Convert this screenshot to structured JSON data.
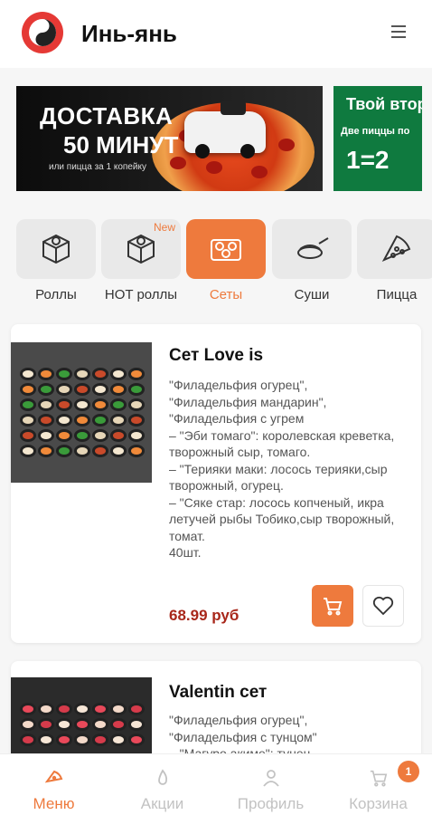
{
  "header": {
    "title": "Инь-янь"
  },
  "banners": [
    {
      "line1": "ДОСТАВКА",
      "line2": "50 МИНУТ",
      "line3": "или пицца за 1 копейку"
    },
    {
      "line1": "Твой втор",
      "line2": "Две пиццы по",
      "line3": "1=2"
    }
  ],
  "categories": [
    {
      "label": "Роллы",
      "icon": "roll-icon",
      "badge": ""
    },
    {
      "label": "HOT роллы",
      "icon": "hot-roll-icon",
      "badge": "New"
    },
    {
      "label": "Сеты",
      "icon": "set-icon",
      "badge": ""
    },
    {
      "label": "Суши",
      "icon": "sushi-icon",
      "badge": ""
    },
    {
      "label": "Пицца",
      "icon": "pizza-icon",
      "badge": ""
    }
  ],
  "products": [
    {
      "title": "Сет Love is",
      "description": "\"Филадельфия огурец\",\n\"Филадельфия мандарин\",\n\"Филадельфия с угрем\n– \"Эби томаго\": королевская креветка, творожный сыр, томаго.\n– \"Терияки маки: лосось терияки,сыр творожный, огурец.\n– \"Сяке стар: лосось копченый, икра летучей рыбы Тобико,сыр творожный, томат.\n40шт.",
      "price": "68.99 руб"
    },
    {
      "title": "Valentin сет",
      "description": "\"Филадельфия огурец\",\n\"Филадельфия с тунцом\"\n– \"Магуро акиме\": тунец",
      "price": ""
    }
  ],
  "bottom_nav": [
    {
      "label": "Меню",
      "icon": "menu-icon"
    },
    {
      "label": "Акции",
      "icon": "promo-icon"
    },
    {
      "label": "Профиль",
      "icon": "profile-icon"
    },
    {
      "label": "Корзина",
      "icon": "cart-icon"
    }
  ],
  "cart_count": "1",
  "colors": {
    "accent": "#ee7a3d",
    "price": "#a8271a",
    "logo": "#e53935"
  }
}
